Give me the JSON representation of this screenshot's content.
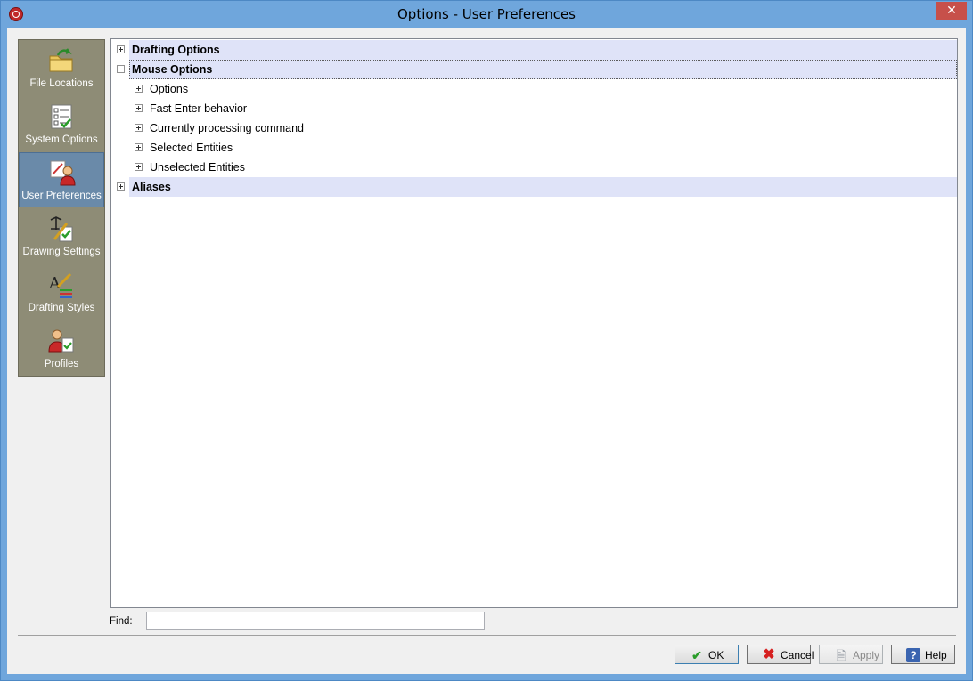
{
  "window": {
    "title": "Options - User Preferences",
    "close_glyph": "✕"
  },
  "sidebar": {
    "items": [
      {
        "label": "File Locations",
        "icon": "folder-arrow-icon",
        "active": false
      },
      {
        "label": "System Options",
        "icon": "checklist-icon",
        "active": false
      },
      {
        "label": "User Preferences",
        "icon": "user-tools-icon",
        "active": true
      },
      {
        "label": "Drawing Settings",
        "icon": "drawing-settings-icon",
        "active": false
      },
      {
        "label": "Drafting Styles",
        "icon": "drafting-styles-icon",
        "active": false
      },
      {
        "label": "Profiles",
        "icon": "profile-icon",
        "active": false
      }
    ]
  },
  "tree": {
    "nodes": [
      {
        "label": "Drafting Options",
        "level": 0,
        "bold": true,
        "expanded": false
      },
      {
        "label": "Mouse Options",
        "level": 0,
        "bold": true,
        "expanded": true
      },
      {
        "label": "Options",
        "level": 1,
        "bold": false,
        "expanded": false
      },
      {
        "label": "Fast Enter behavior",
        "level": 1,
        "bold": false,
        "expanded": false
      },
      {
        "label": "Currently processing command",
        "level": 1,
        "bold": false,
        "expanded": false
      },
      {
        "label": "Selected Entities",
        "level": 1,
        "bold": false,
        "expanded": false
      },
      {
        "label": "Unselected Entities",
        "level": 1,
        "bold": false,
        "expanded": false
      },
      {
        "label": "Aliases",
        "level": 0,
        "bold": true,
        "expanded": false
      }
    ]
  },
  "find": {
    "label": "Find:",
    "value": ""
  },
  "buttons": {
    "ok": "OK",
    "cancel": "Cancel",
    "apply": "Apply",
    "help": "Help"
  },
  "colors": {
    "accent": "#6fa6dc",
    "sidebar_bg": "#8e8c76",
    "sidebar_active": "#6a8aa9",
    "row_highlight": "#dfe3f8",
    "ok_check": "#2a9d2a",
    "cancel_x": "#d62020"
  }
}
